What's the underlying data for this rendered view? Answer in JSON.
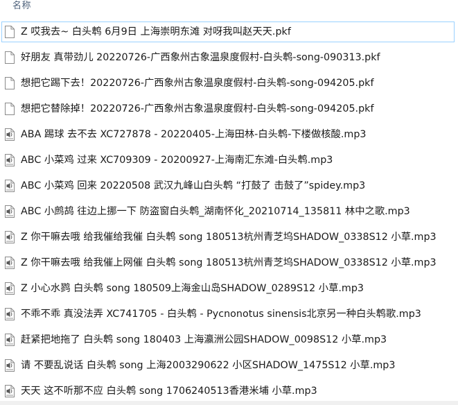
{
  "header": {
    "name_label": "名称"
  },
  "files": [
    {
      "name": "Z 哎我去~ 白头鹎 6月9日 上海崇明东滩 对呀我叫赵天天.pkf",
      "icon": "blank-file-icon",
      "selected": true
    },
    {
      "name": "好朋友 真带劲儿 20220726-广西象州古象温泉度假村-白头鹎-song-090313.pkf",
      "icon": "blank-file-icon",
      "selected": false
    },
    {
      "name": "想把它踢下去！20220726-广西象州古象温泉度假村-白头鹎-song-094205.pkf",
      "icon": "blank-file-icon",
      "selected": false
    },
    {
      "name": "想把它替除掉！20220726-广西象州古象温泉度假村-白头鹎-song-094205.pkf",
      "icon": "blank-file-icon",
      "selected": false
    },
    {
      "name": "ABA 踢球 去不去 XC727878 - 20220405-上海田林-白头鹎-下楼做核酸.mp3",
      "icon": "audio-file-icon",
      "selected": false
    },
    {
      "name": "ABC 小菜鸡 过来 XC709309 - 20200927-上海南汇东滩-白头鹎.mp3",
      "icon": "audio-file-icon",
      "selected": false
    },
    {
      "name": "ABC 小菜鸡 回来 20220508 武汉九峰山白头鹎 “打鼓了 击鼓了”spidey.mp3",
      "icon": "audio-file-icon",
      "selected": false
    },
    {
      "name": "ABC 小鹧鸪 往边上挪一下 防盗窗白头鹎_湖南怀化_20210714_135811 林中之歌.mp3",
      "icon": "audio-file-icon",
      "selected": false
    },
    {
      "name": "Z 你干嘛去哦 给我催给我催 白头鹎 song 180513杭州青芝坞SHADOW_0338S12 小草.mp3",
      "icon": "audio-file-icon",
      "selected": false
    },
    {
      "name": "Z 你干嘛去哦 给我催上网催 白头鹎 song 180513杭州青芝坞SHADOW_0338S12 小草.mp3",
      "icon": "audio-file-icon",
      "selected": false
    },
    {
      "name": "Z 小心水鹨 白头鹎 song 180509上海金山岛SHADOW_0289S12 小草.mp3",
      "icon": "audio-file-icon",
      "selected": false
    },
    {
      "name": "不乖不乖 真没法弄 XC741705 - 白头鹎 - Pycnonotus sinensis北京另一种白头鹎歌.mp3",
      "icon": "audio-file-icon",
      "selected": false
    },
    {
      "name": "赶紧把地拖了 白头鹎 song 180403 上海瀛洲公园SHADOW_0098S12 小草.mp3",
      "icon": "audio-file-icon",
      "selected": false
    },
    {
      "name": "请 不要乱说话 白头鹎 song 上海2003290622 小区SHADOW_1475S12 小草.mp3",
      "icon": "audio-file-icon",
      "selected": false
    },
    {
      "name": "天天 这不听那不应 白头鹎 song 1706240513香港米埔 小草.mp3",
      "icon": "audio-file-icon",
      "selected": false
    }
  ]
}
